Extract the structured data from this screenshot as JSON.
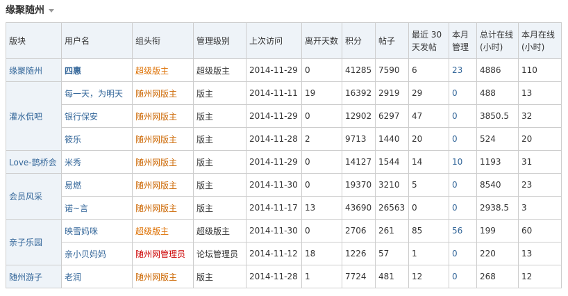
{
  "section": {
    "title": "缘聚随州"
  },
  "columns": [
    "版块",
    "用户名",
    "组头衔",
    "管理级别",
    "上次访问",
    "离开天数",
    "积分",
    "帖子",
    "最近 30 天发帖",
    "本月管理",
    "总计在线 (小时)",
    "本月在线 (小时)"
  ],
  "rows": [
    {
      "board": "缘聚随州",
      "user": "四惠",
      "title": "超级版主",
      "level": "超级版主",
      "last_visit": "2014-11-29",
      "days_away": "0",
      "points": "41285",
      "posts": "7590",
      "posts30": "6",
      "manage_month": "23",
      "online_total": "4886",
      "online_month": "110"
    },
    {
      "board": "灌水侃吧",
      "user": "每一天，为明天",
      "title": "随州网版主",
      "level": "版主",
      "last_visit": "2014-11-11",
      "days_away": "19",
      "points": "16392",
      "posts": "2919",
      "posts30": "29",
      "manage_month": "0",
      "online_total": "488",
      "online_month": "13"
    },
    {
      "board": "",
      "user": "银行保安",
      "title": "随州网版主",
      "level": "版主",
      "last_visit": "2014-11-29",
      "days_away": "0",
      "points": "12902",
      "posts": "6297",
      "posts30": "47",
      "manage_month": "0",
      "online_total": "3850.5",
      "online_month": "32"
    },
    {
      "board": "",
      "user": "筱乐",
      "title": "随州网版主",
      "level": "版主",
      "last_visit": "2014-11-28",
      "days_away": "2",
      "points": "9713",
      "posts": "1440",
      "posts30": "20",
      "manage_month": "0",
      "online_total": "524",
      "online_month": "20"
    },
    {
      "board": "Love-鹊桥会",
      "user": "米秀",
      "title": "随州网版主",
      "level": "版主",
      "last_visit": "2014-11-29",
      "days_away": "0",
      "points": "14127",
      "posts": "1544",
      "posts30": "14",
      "manage_month": "10",
      "online_total": "1193",
      "online_month": "31"
    },
    {
      "board": "会员风采",
      "user": "易燃",
      "title": "随州网版主",
      "level": "版主",
      "last_visit": "2014-11-30",
      "days_away": "0",
      "points": "19370",
      "posts": "3210",
      "posts30": "5",
      "manage_month": "0",
      "online_total": "8540",
      "online_month": "23"
    },
    {
      "board": "",
      "user": "诺~言",
      "title": "随州网版主",
      "level": "版主",
      "last_visit": "2014-11-17",
      "days_away": "13",
      "points": "43690",
      "posts": "26563",
      "posts30": "0",
      "manage_month": "0",
      "online_total": "2938.5",
      "online_month": "3"
    },
    {
      "board": "亲子乐园",
      "user": "映雪妈咪",
      "title": "超级版主",
      "level": "超级版主",
      "last_visit": "2014-11-30",
      "days_away": "0",
      "points": "2706",
      "posts": "261",
      "posts30": "85",
      "manage_month": "56",
      "online_total": "199",
      "online_month": "60"
    },
    {
      "board": "",
      "user": "亲小贝妈妈",
      "title": "随州网管理员",
      "level": "论坛管理员",
      "last_visit": "2014-11-12",
      "days_away": "18",
      "points": "1226",
      "posts": "57",
      "posts30": "1",
      "manage_month": "0",
      "online_total": "220",
      "online_month": "13"
    },
    {
      "board": "随州游子",
      "user": "老润",
      "title": "随州网版主",
      "level": "版主",
      "last_visit": "2014-11-28",
      "days_away": "1",
      "points": "7724",
      "posts": "481",
      "posts30": "12",
      "manage_month": "0",
      "online_total": "268",
      "online_month": "12"
    }
  ]
}
